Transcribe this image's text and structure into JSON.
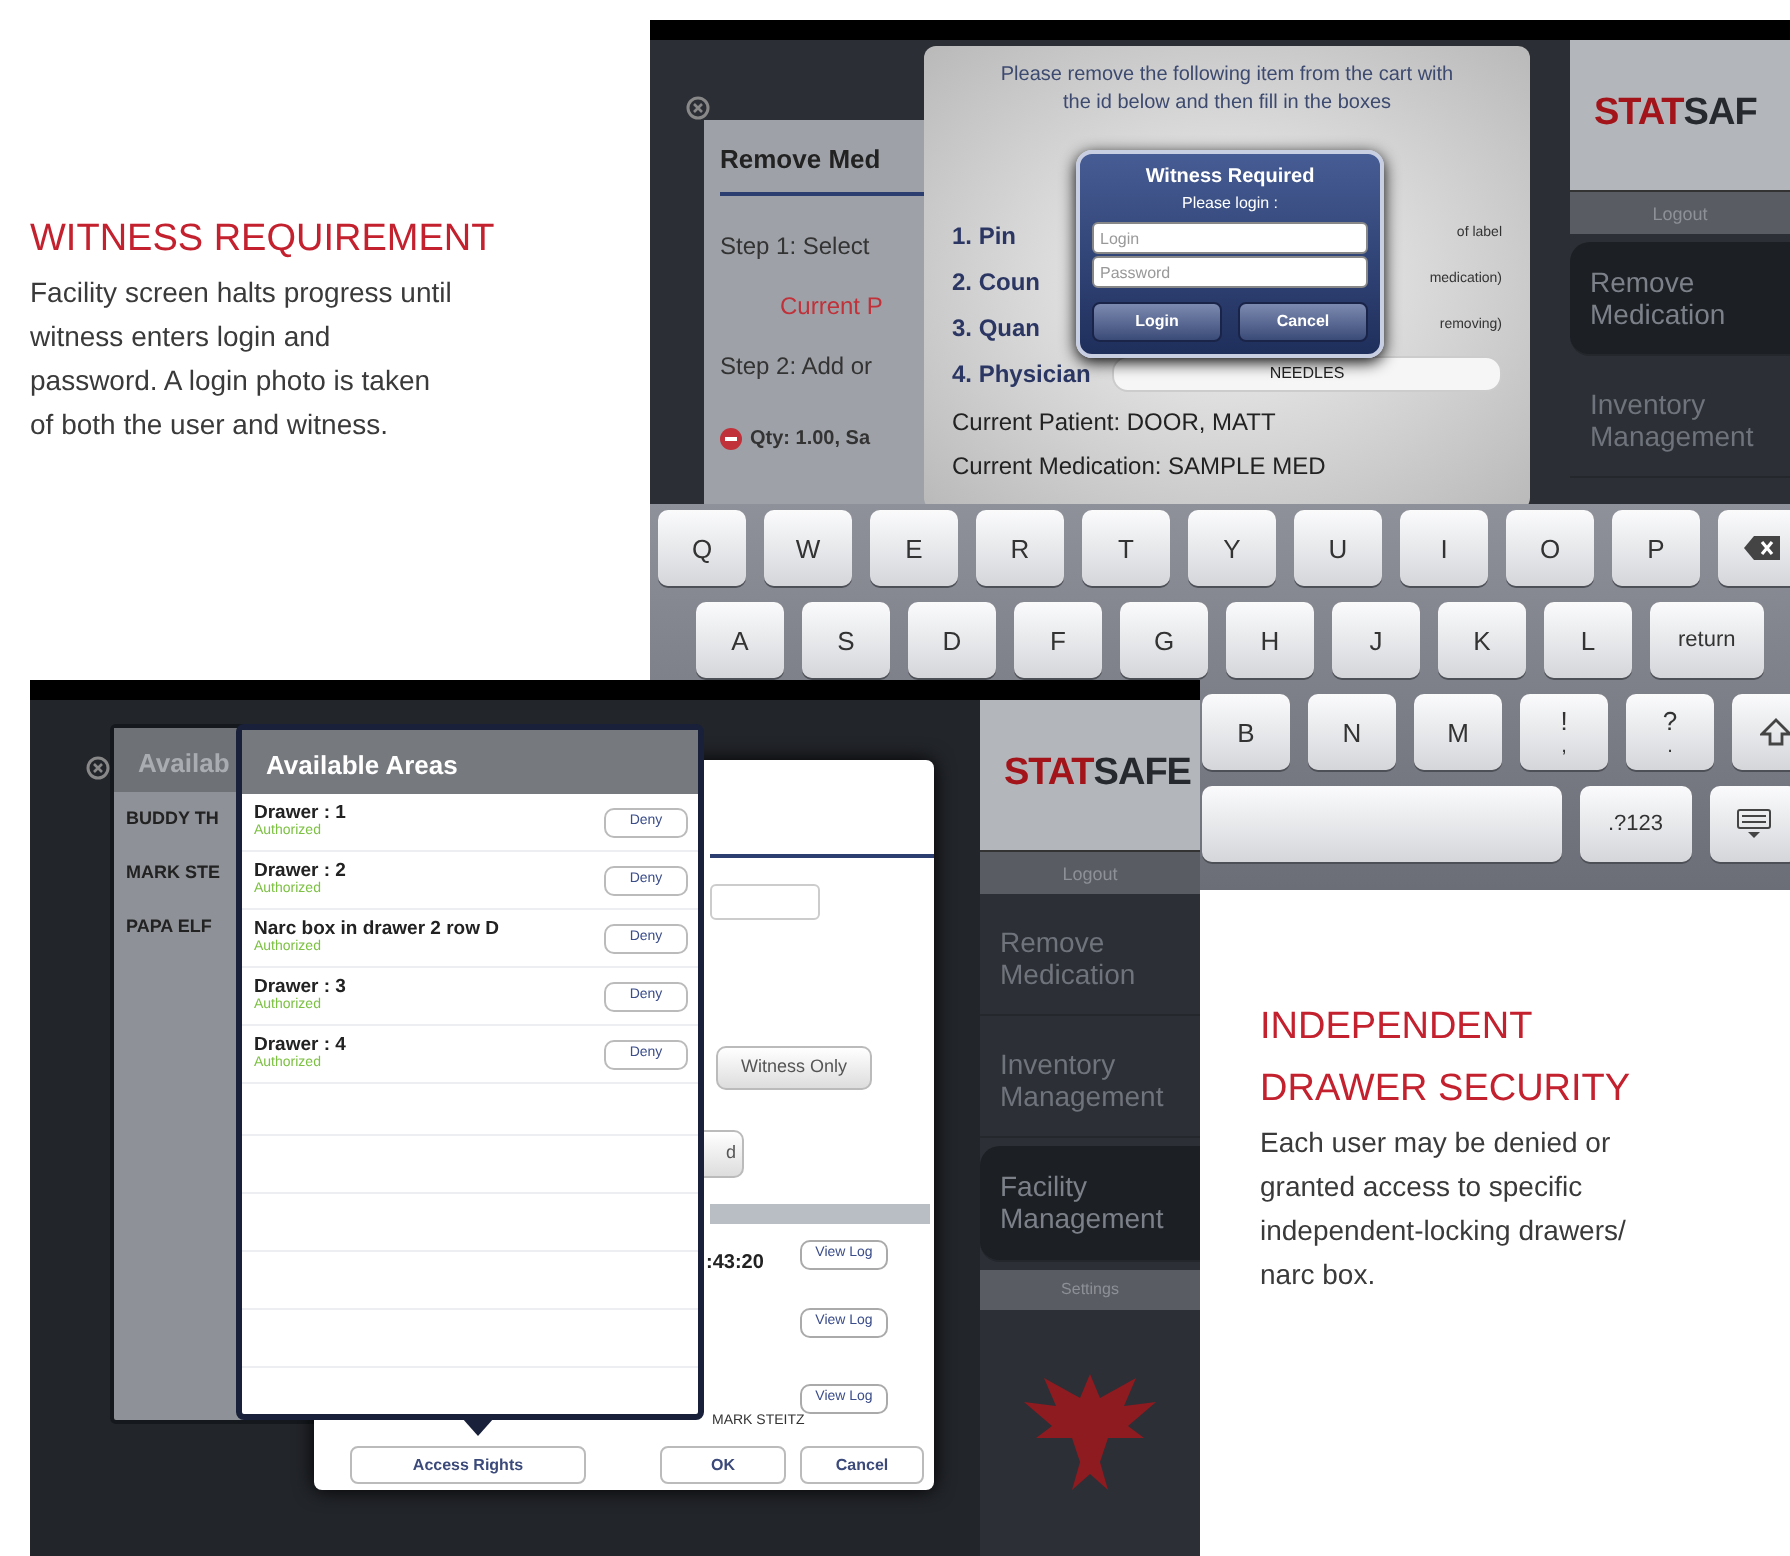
{
  "captions": [
    {
      "title": "WITNESS REQUIREMENT",
      "body": "Facility screen halts progress until witness enters login and password. A login photo is taken of both the user and witness."
    },
    {
      "title": "INDEPENDENT DRAWER SECURITY",
      "body": "Each user may be denied or granted access to specific independent-locking drawers/ narc box."
    }
  ],
  "witness_screen": {
    "back_panel": {
      "title": "Remove Med",
      "lines": [
        {
          "kind": "step",
          "text": "Step 1:  Select"
        },
        {
          "kind": "alert",
          "text": "Current P"
        },
        {
          "kind": "step",
          "text": "Step 2:  Add or"
        },
        {
          "kind": "item",
          "text": "Qty: 1.00, Sa"
        }
      ]
    },
    "dialog": {
      "message": "Please remove the following item from the cart with the id below and then fill in the boxes",
      "fields": [
        {
          "label": "1. Pin",
          "hint": "of label"
        },
        {
          "label": "2. Coun",
          "hint": "medication)"
        },
        {
          "label": "3. Quan",
          "hint": "removing)"
        },
        {
          "label": "4. Physician",
          "value": "NEEDLES"
        }
      ],
      "patient": "Current Patient: DOOR, MATT",
      "medication": "Current Medication: SAMPLE MED"
    },
    "alert": {
      "title": "Witness Required",
      "subtitle": "Please login :",
      "login_placeholder": "Login",
      "password_placeholder": "Password",
      "buttons": [
        "Login",
        "Cancel"
      ]
    },
    "sidebar": {
      "logo": [
        "STAT",
        "SAF"
      ],
      "logout": "Logout",
      "items": [
        {
          "label": "Remove Medication",
          "selected": true
        },
        {
          "label": "Inventory Management",
          "selected": false
        }
      ]
    },
    "keyboard": {
      "rows": [
        [
          {
            "kind": "key",
            "label": "Q"
          },
          {
            "kind": "key",
            "label": "W"
          },
          {
            "kind": "key",
            "label": "E"
          },
          {
            "kind": "key",
            "label": "R"
          },
          {
            "kind": "key",
            "label": "T"
          },
          {
            "kind": "key",
            "label": "Y"
          },
          {
            "kind": "key",
            "label": "U"
          },
          {
            "kind": "key",
            "label": "I"
          },
          {
            "kind": "key",
            "label": "O"
          },
          {
            "kind": "key",
            "label": "P"
          },
          {
            "kind": "backspace"
          }
        ],
        [
          {
            "kind": "key",
            "label": "A"
          },
          {
            "kind": "key",
            "label": "S"
          },
          {
            "kind": "key",
            "label": "D"
          },
          {
            "kind": "key",
            "label": "F"
          },
          {
            "kind": "key",
            "label": "G"
          },
          {
            "kind": "key",
            "label": "H"
          },
          {
            "kind": "key",
            "label": "J"
          },
          {
            "kind": "key",
            "label": "K"
          },
          {
            "kind": "key",
            "label": "L"
          },
          {
            "kind": "wide",
            "label": "return"
          }
        ],
        [
          {
            "kind": "cut",
            "label": "B"
          },
          {
            "kind": "key",
            "label": "N"
          },
          {
            "kind": "key",
            "label": "M"
          },
          {
            "kind": "key",
            "label": "!",
            "sublabel": ","
          },
          {
            "kind": "key",
            "label": "?",
            "sublabel": "."
          },
          {
            "kind": "shift"
          }
        ],
        [
          {
            "kind": "space"
          },
          {
            "kind": "wide",
            "label": ".?123"
          },
          {
            "kind": "hide"
          }
        ]
      ]
    }
  },
  "access_screen": {
    "users_panel": {
      "title": "Availab",
      "users": [
        "BUDDY TH",
        "MARK STE",
        "PAPA ELF"
      ]
    },
    "dialog": {
      "role_button": "Witness Only",
      "cut_button": "d",
      "time": ":43:20",
      "log_buttons": [
        "View Log",
        "View Log",
        "View Log"
      ],
      "user": "MARK STEITZ",
      "buttons": [
        "Access Rights",
        "OK",
        "Cancel"
      ]
    },
    "popover": {
      "title": "Available Areas",
      "areas": [
        {
          "name": "Drawer : 1",
          "status": "Authorized",
          "action": "Deny"
        },
        {
          "name": "Drawer : 2",
          "status": "Authorized",
          "action": "Deny"
        },
        {
          "name": "Narc box in drawer 2 row D",
          "status": "Authorized",
          "action": "Deny"
        },
        {
          "name": "Drawer : 3",
          "status": "Authorized",
          "action": "Deny"
        },
        {
          "name": "Drawer : 4",
          "status": "Authorized",
          "action": "Deny"
        }
      ]
    },
    "sidebar": {
      "logo": [
        "STAT",
        "SAFE"
      ],
      "logout": "Logout",
      "items": [
        {
          "label": "Remove Medication",
          "selected": false
        },
        {
          "label": "Inventory Management",
          "selected": false
        },
        {
          "label": "Facility Management",
          "selected": true
        }
      ],
      "settings": "Settings"
    }
  }
}
